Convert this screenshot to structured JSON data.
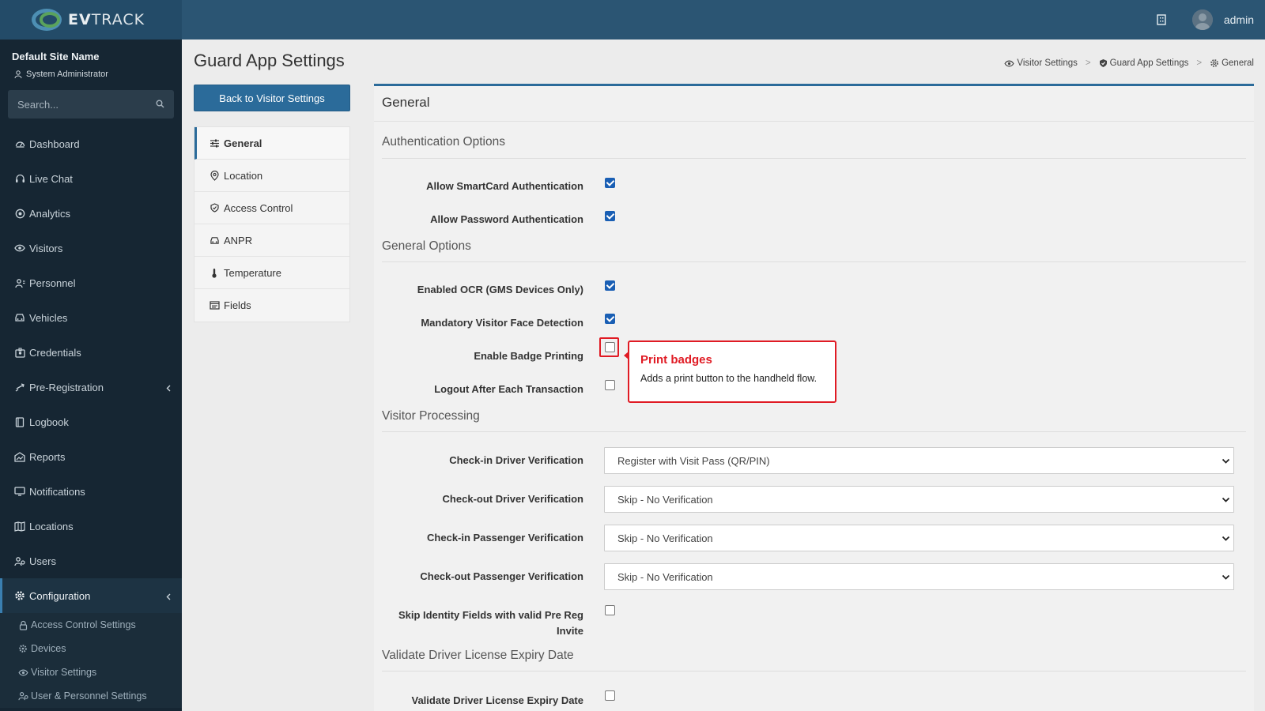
{
  "header": {
    "logo_prefix": "EV",
    "logo_suffix": "TRACK",
    "user": "admin"
  },
  "sidebar": {
    "site_name": "Default Site Name",
    "role": "System Administrator",
    "search_placeholder": "Search...",
    "items": [
      {
        "label": "Dashboard",
        "icon": "dashboard-icon"
      },
      {
        "label": "Live Chat",
        "icon": "headset-icon"
      },
      {
        "label": "Analytics",
        "icon": "analytics-icon"
      },
      {
        "label": "Visitors",
        "icon": "eye-icon"
      },
      {
        "label": "Personnel",
        "icon": "personnel-icon"
      },
      {
        "label": "Vehicles",
        "icon": "car-icon"
      },
      {
        "label": "Credentials",
        "icon": "credentials-icon"
      },
      {
        "label": "Pre-Registration",
        "icon": "arrows-icon"
      },
      {
        "label": "Logbook",
        "icon": "book-icon"
      },
      {
        "label": "Reports",
        "icon": "reports-icon"
      },
      {
        "label": "Notifications",
        "icon": "bell-icon"
      },
      {
        "label": "Locations",
        "icon": "map-icon"
      },
      {
        "label": "Users",
        "icon": "users-icon"
      },
      {
        "label": "Configuration",
        "icon": "gear-icon"
      }
    ],
    "sub_items": [
      {
        "label": "Access Control Settings",
        "icon": "lock-icon"
      },
      {
        "label": "Devices",
        "icon": "device-icon"
      },
      {
        "label": "Visitor Settings",
        "icon": "eye-icon"
      },
      {
        "label": "User & Personnel Settings",
        "icon": "users-icon"
      }
    ]
  },
  "page": {
    "title": "Guard App Settings",
    "back_button": "Back to Visitor Settings",
    "breadcrumb": [
      "Visitor Settings",
      "Guard App Settings",
      "General"
    ]
  },
  "settings_nav": [
    {
      "label": "General",
      "icon": "sliders-icon"
    },
    {
      "label": "Location",
      "icon": "pin-icon"
    },
    {
      "label": "Access Control",
      "icon": "shield-icon"
    },
    {
      "label": "ANPR",
      "icon": "car-icon"
    },
    {
      "label": "Temperature",
      "icon": "thermometer-icon"
    },
    {
      "label": "Fields",
      "icon": "fields-icon"
    }
  ],
  "panel": {
    "title": "General",
    "sections": {
      "auth": "Authentication Options",
      "general": "General Options",
      "visitor": "Visitor Processing",
      "license": "Validate Driver License Expiry Date"
    },
    "rows": {
      "smartcard": {
        "label": "Allow SmartCard Authentication",
        "checked": true
      },
      "password": {
        "label": "Allow Password Authentication",
        "checked": true
      },
      "ocr": {
        "label": "Enabled OCR (GMS Devices Only)",
        "checked": true
      },
      "face": {
        "label": "Mandatory Visitor Face Detection",
        "checked": true
      },
      "badge": {
        "label": "Enable Badge Printing",
        "checked": false
      },
      "logout": {
        "label": "Logout After Each Transaction",
        "checked": false
      },
      "skip_identity": {
        "label": "Skip Identity Fields with valid Pre Reg Invite",
        "checked": false
      },
      "validate_license": {
        "label": "Validate Driver License Expiry Date",
        "checked": false
      }
    },
    "selects": {
      "checkin_driver": {
        "label": "Check-in Driver Verification",
        "value": "Register with Visit Pass (QR/PIN)"
      },
      "checkout_driver": {
        "label": "Check-out Driver Verification",
        "value": "Skip - No Verification"
      },
      "checkin_passenger": {
        "label": "Check-in Passenger Verification",
        "value": "Skip - No Verification"
      },
      "checkout_passenger": {
        "label": "Check-out Passenger Verification",
        "value": "Skip - No Verification"
      }
    }
  },
  "tooltip": {
    "title": "Print badges",
    "body": "Adds a print button to the handheld flow."
  },
  "colors": {
    "header": "#2b5573",
    "sidebar": "#162633",
    "primary": "#2b6b9a",
    "highlight": "#e01b24",
    "checkbox": "#1a5fb4"
  }
}
